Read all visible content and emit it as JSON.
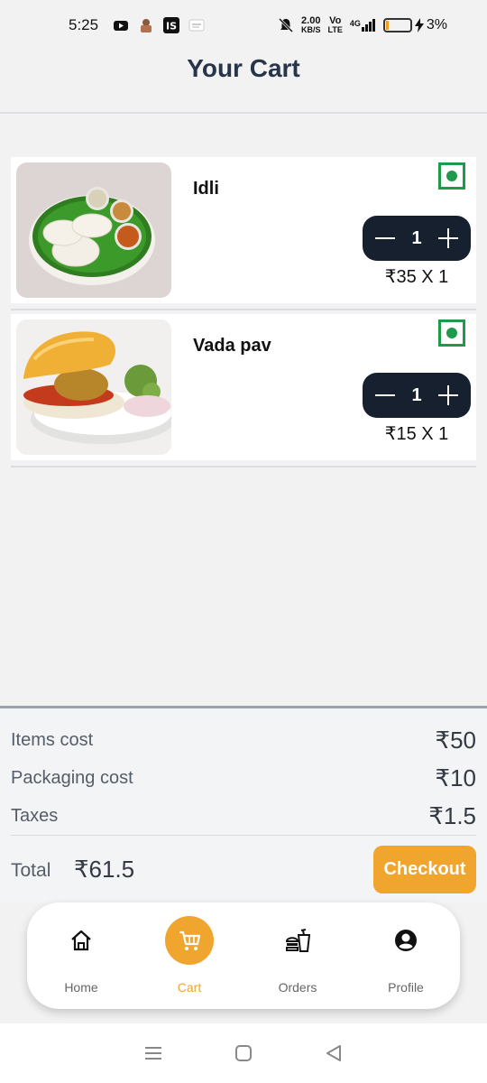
{
  "status_bar": {
    "time": "5:25",
    "net_speed_value": "2.00",
    "net_speed_unit": "KB/S",
    "volte_top": "Vo",
    "volte_bottom": "LTE",
    "network": "4G",
    "battery": "3%"
  },
  "header": {
    "title": "Your Cart"
  },
  "cart": {
    "items": [
      {
        "name": "Idli",
        "quantity": "1",
        "price_line": "₹35 X 1",
        "veg": true
      },
      {
        "name": "Vada pav",
        "quantity": "1",
        "price_line": "₹15 X 1",
        "veg": true
      }
    ]
  },
  "summary": {
    "items_cost_label": "Items cost",
    "items_cost_value": "₹50",
    "packaging_label": "Packaging cost",
    "packaging_value": "₹10",
    "taxes_label": "Taxes",
    "taxes_value": "₹1.5",
    "total_label": "Total",
    "total_value": "₹61.5",
    "checkout_label": "Checkout"
  },
  "bottom_nav": {
    "items": [
      {
        "label": "Home",
        "icon": "home-icon"
      },
      {
        "label": "Cart",
        "icon": "cart-icon",
        "active": true
      },
      {
        "label": "Orders",
        "icon": "orders-icon"
      },
      {
        "label": "Profile",
        "icon": "profile-icon"
      }
    ]
  },
  "colors": {
    "accent": "#f0a52e",
    "stepper_bg": "#16202f",
    "veg_green": "#1f9a4a",
    "title": "#27344a"
  }
}
